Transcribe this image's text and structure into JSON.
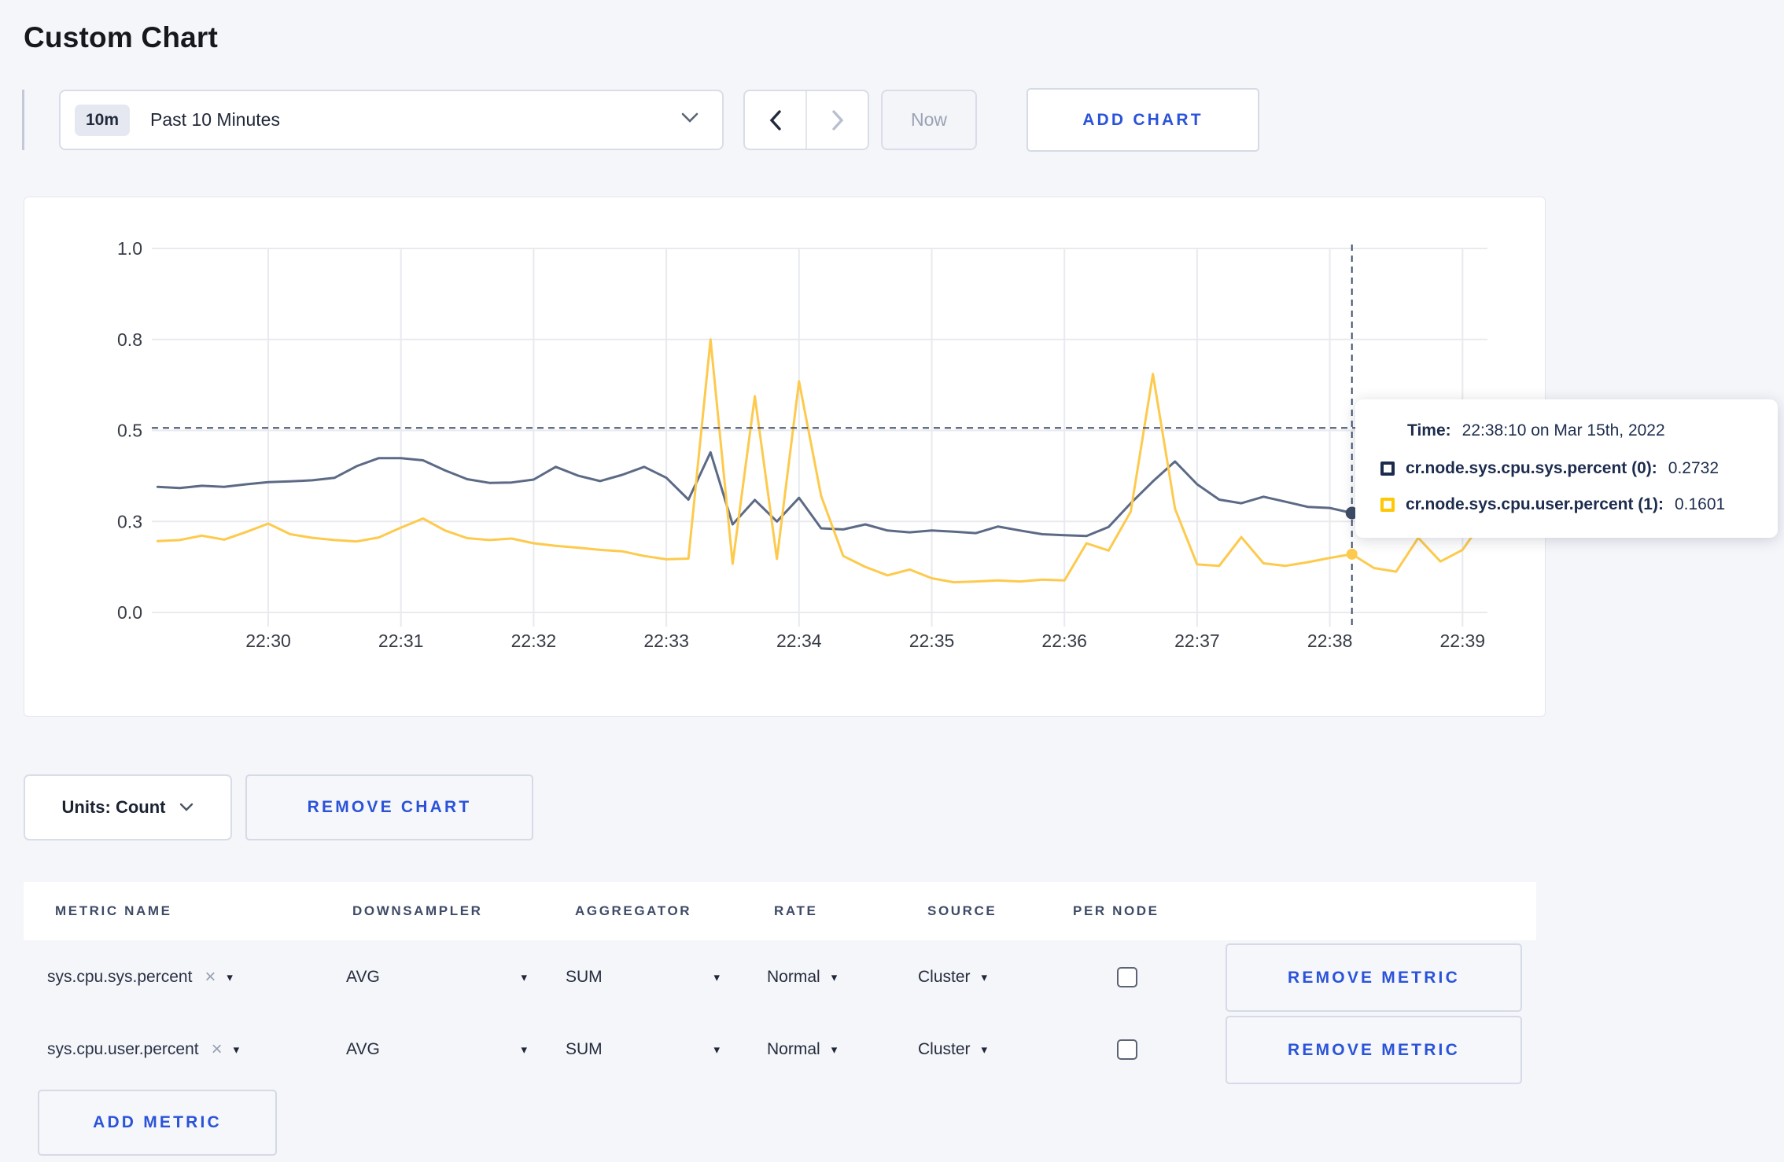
{
  "page": {
    "title": "Custom Chart",
    "background": "#f5f6fa"
  },
  "toolbar": {
    "time_range": {
      "badge": "10m",
      "label": "Past 10 Minutes"
    },
    "now_label": "Now",
    "add_chart_label": "ADD CHART"
  },
  "tooltip": {
    "time_label": "Time:",
    "time_value": "22:38:10 on Mar 15th, 2022",
    "series": [
      {
        "label": "cr.node.sys.cpu.sys.percent (0):",
        "value": "0.2732",
        "swatch_color": "#1c2a4e"
      },
      {
        "label": "cr.node.sys.cpu.user.percent (1):",
        "value": "0.1601",
        "swatch_color": "#fec802"
      }
    ]
  },
  "chart_actions": {
    "units_label": "Units: Count",
    "remove_chart_label": "REMOVE CHART"
  },
  "metrics_table": {
    "headers": [
      "METRIC NAME",
      "DOWNSAMPLER",
      "AGGREGATOR",
      "RATE",
      "SOURCE",
      "PER NODE"
    ],
    "clear_glyph": "×",
    "caret_glyph": "▾",
    "rows": [
      {
        "name": "sys.cpu.sys.percent",
        "downsampler": "AVG",
        "aggregator": "SUM",
        "rate": "Normal",
        "source": "Cluster",
        "per_node_checked": false,
        "remove_label": "REMOVE METRIC"
      },
      {
        "name": "sys.cpu.user.percent",
        "downsampler": "AVG",
        "aggregator": "SUM",
        "rate": "Normal",
        "source": "Cluster",
        "per_node_checked": false,
        "remove_label": "REMOVE METRIC"
      }
    ],
    "add_metric_label": "ADD METRIC"
  },
  "chart_data": {
    "type": "line",
    "title": "",
    "xlabel": "",
    "ylabel": "",
    "ylim": [
      0,
      1
    ],
    "grid": true,
    "legend_position": "none",
    "yticks": {
      "values": [
        0,
        0.25,
        0.5,
        0.75,
        1.0
      ],
      "labels": [
        "0.0",
        "0.3",
        "0.5",
        "0.8",
        "1.0"
      ]
    },
    "xticks": [
      "22:30",
      "22:31",
      "22:32",
      "22:33",
      "22:34",
      "22:35",
      "22:36",
      "22:37",
      "22:38",
      "22:39"
    ],
    "x_start_time": "22:29:10",
    "t_start_seconds": -50,
    "step_seconds": 10,
    "grid_color": "#e8eaef",
    "axis_text_color": "#363b45",
    "crosshair": {
      "time": "22:38:10",
      "t_seconds": 490,
      "mouse_value": 0.507,
      "color": "#3f506b",
      "sys_value": 0.2732,
      "user_value": 0.1601
    },
    "series": [
      {
        "name": "cr.node.sys.cpu.sys.percent",
        "color": "#5c6a86",
        "values": [
          0.345,
          0.342,
          0.348,
          0.345,
          0.352,
          0.358,
          0.36,
          0.363,
          0.37,
          0.402,
          0.424,
          0.424,
          0.418,
          0.39,
          0.366,
          0.356,
          0.357,
          0.365,
          0.4,
          0.376,
          0.361,
          0.378,
          0.4,
          0.37,
          0.31,
          0.44,
          0.242,
          0.309,
          0.25,
          0.315,
          0.231,
          0.228,
          0.242,
          0.225,
          0.22,
          0.225,
          0.222,
          0.218,
          0.236,
          0.225,
          0.215,
          0.212,
          0.21,
          0.235,
          0.3,
          0.36,
          0.415,
          0.352,
          0.31,
          0.3,
          0.318,
          0.304,
          0.29,
          0.287,
          0.2732,
          0.302,
          0.31,
          0.3,
          0.296,
          0.302,
          0.308
        ]
      },
      {
        "name": "cr.node.sys.cpu.user.percent",
        "color": "#fdca4d",
        "values": [
          0.196,
          0.199,
          0.211,
          0.2,
          0.221,
          0.244,
          0.215,
          0.205,
          0.199,
          0.195,
          0.206,
          0.233,
          0.258,
          0.225,
          0.204,
          0.199,
          0.203,
          0.19,
          0.183,
          0.178,
          0.172,
          0.168,
          0.155,
          0.146,
          0.148,
          0.75,
          0.134,
          0.594,
          0.147,
          0.635,
          0.32,
          0.155,
          0.125,
          0.102,
          0.118,
          0.094,
          0.083,
          0.085,
          0.088,
          0.085,
          0.09,
          0.088,
          0.19,
          0.17,
          0.277,
          0.655,
          0.285,
          0.132,
          0.128,
          0.207,
          0.135,
          0.128,
          0.138,
          0.15,
          0.1601,
          0.122,
          0.112,
          0.205,
          0.14,
          0.172,
          0.258
        ]
      }
    ]
  }
}
